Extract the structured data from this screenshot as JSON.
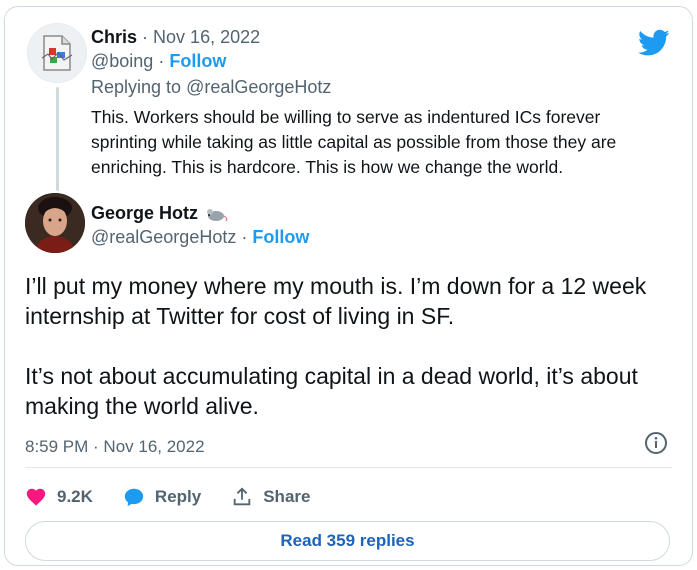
{
  "parent_tweet": {
    "name": "Chris",
    "separator": "·",
    "date": "Nov 16, 2022",
    "handle": "@boing",
    "follow_label": "Follow",
    "replying_prefix": "Replying to",
    "replying_to": "@realGeorgeHotz",
    "text": "This. Workers should be willing to serve as indentured ICs forever sprinting while taking as little capital as possible from those they are enriching. This is hardcore. This is how we change the world."
  },
  "main_tweet": {
    "name": "George Hotz",
    "name_emoji": "rat-emoji",
    "handle": "@realGeorgeHotz",
    "separator": "·",
    "follow_label": "Follow",
    "paragraphs": [
      "I’ll put my money where my mouth is. I’m down for a 12 week internship at Twitter for cost of living in SF.",
      "It’s not about accumulating capital in a dead world, it’s about making the world alive."
    ],
    "timestamp": "8:59 PM · Nov 16, 2022"
  },
  "actions": {
    "like_count": "9.2K",
    "reply_label": "Reply",
    "share_label": "Share"
  },
  "read_replies_label": "Read 359 replies",
  "colors": {
    "twitter_blue": "#1d9bf0",
    "like_pink": "#f91880",
    "text": "#0f1419",
    "muted": "#536471",
    "border": "#cfd9de"
  },
  "icons": [
    "twitter-bird-icon",
    "info-icon",
    "heart-icon",
    "reply-bubble-icon",
    "share-icon",
    "broken-image-icon"
  ]
}
